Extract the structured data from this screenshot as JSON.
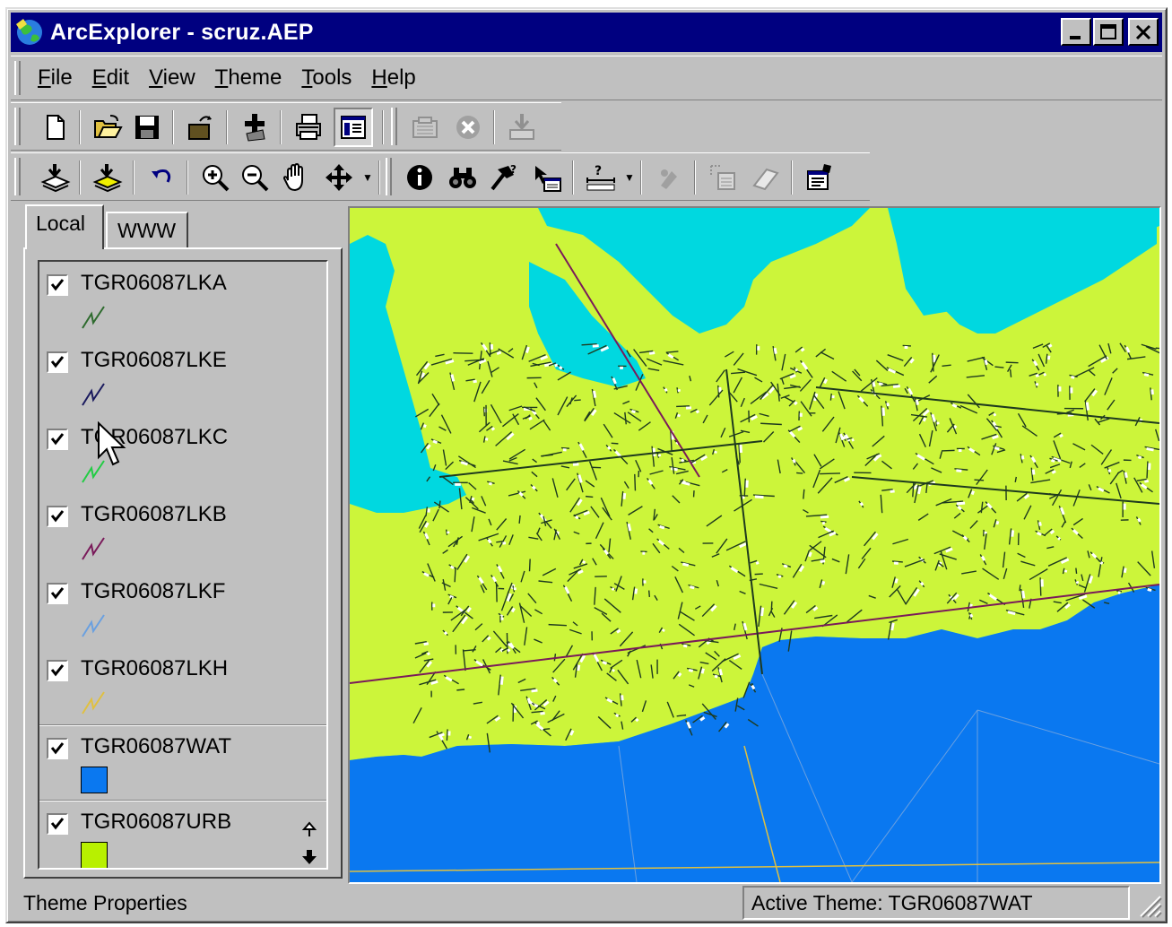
{
  "window": {
    "title": "ArcExplorer - scruz.AEP"
  },
  "menu": [
    "File",
    "Edit",
    "View",
    "Theme",
    "Tools",
    "Help"
  ],
  "toolbar1": [
    "new-icon",
    "open-icon",
    "save-icon",
    "open-theme-icon",
    "add-theme-icon",
    "print-icon",
    "legend-toggle-icon",
    "catalog-icon",
    "stop-icon",
    "export-icon"
  ],
  "toolbar2": [
    "add-layer-icon",
    "add-layer-yellow-icon",
    "undo-icon",
    "zoom-in-icon",
    "zoom-out-icon",
    "pan-hand-icon",
    "pan-icon",
    "identify-icon",
    "find-icon",
    "query-icon",
    "spatial-query-icon",
    "measure-icon",
    "tool1-icon",
    "select-icon",
    "erase-icon",
    "properties-icon"
  ],
  "tabs": {
    "local": "Local",
    "www": "WWW"
  },
  "layers": [
    {
      "name": "TGR06087LKA",
      "color": "#2e6b2e",
      "type": "line"
    },
    {
      "name": "TGR06087LKE",
      "color": "#1a1a5e",
      "type": "line"
    },
    {
      "name": "TGR06087LKC",
      "color": "#22cc44",
      "type": "line"
    },
    {
      "name": "TGR06087LKB",
      "color": "#7a1a5a",
      "type": "line"
    },
    {
      "name": "TGR06087LKF",
      "color": "#6aa0e0",
      "type": "line"
    },
    {
      "name": "TGR06087LKH",
      "color": "#e0c040",
      "type": "line"
    },
    {
      "name": "TGR06087WAT",
      "color": "#0a78f0",
      "type": "polygon"
    },
    {
      "name": "TGR06087URB",
      "color": "#b8f000",
      "type": "polygon"
    }
  ],
  "colors": {
    "land": "#ccf53a",
    "water_bay": "#0a78f0",
    "water_lagoon": "#00d8e0",
    "road": "#1e3a1e"
  },
  "status": {
    "left": "Theme Properties",
    "right": "Active Theme: TGR06087WAT"
  }
}
